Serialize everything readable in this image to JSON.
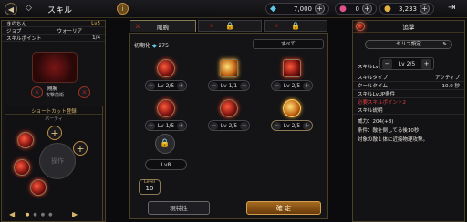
{
  "topbar": {
    "title": "スキル",
    "info": "i",
    "crystal": "7,000",
    "gem": "0",
    "gold": "3,233"
  },
  "tabs": [
    {
      "label": "剛腕",
      "active": true
    },
    {
      "label": "",
      "locked": true
    },
    {
      "label": "",
      "locked": true
    }
  ],
  "char": {
    "name": "きのちん",
    "level": "Lv5",
    "job_label": "ジョブ",
    "job": "ウォーリア",
    "sp_label": "スキルポイント",
    "sp": "1/4",
    "skill_name": "剛腕",
    "skill_sub": "攻撃前衛"
  },
  "shortcut": {
    "title": "ショートカット登録",
    "sub": "パーティ",
    "center": "操作"
  },
  "init": {
    "label": "初期化",
    "value": "275",
    "all": "すべて"
  },
  "skills": [
    {
      "lv": "Lv 2/5"
    },
    {
      "lv": "Lv 1/1"
    },
    {
      "lv": "Lv 2/5"
    },
    {
      "lv": "Lv 1/5"
    },
    {
      "lv": "Lv 2/5"
    },
    {
      "lv": "Lv 2/5"
    },
    {
      "lv": "Lv8"
    }
  ],
  "level_marker": {
    "label": "Level",
    "value": "10"
  },
  "bottom": {
    "left": "現特性",
    "right": "確 定"
  },
  "detail": {
    "header": "追撃",
    "setting": "セリフ設定",
    "skill_lv_label": "スキルLv",
    "skill_lv": "Lv 2/5",
    "rows": [
      [
        "スキルタイプ",
        "アクティブ"
      ],
      [
        "クールタイム",
        "10.0 秒"
      ]
    ],
    "cond_label": "スキルLvUP条件",
    "cond": "必要スキルポイント2",
    "desc_label": "スキル説明",
    "power": "威力：204(+8)",
    "cond2": "条件：敵を倒してる後10秒",
    "desc": "対象の敵１体に近接物理攻撃。"
  }
}
